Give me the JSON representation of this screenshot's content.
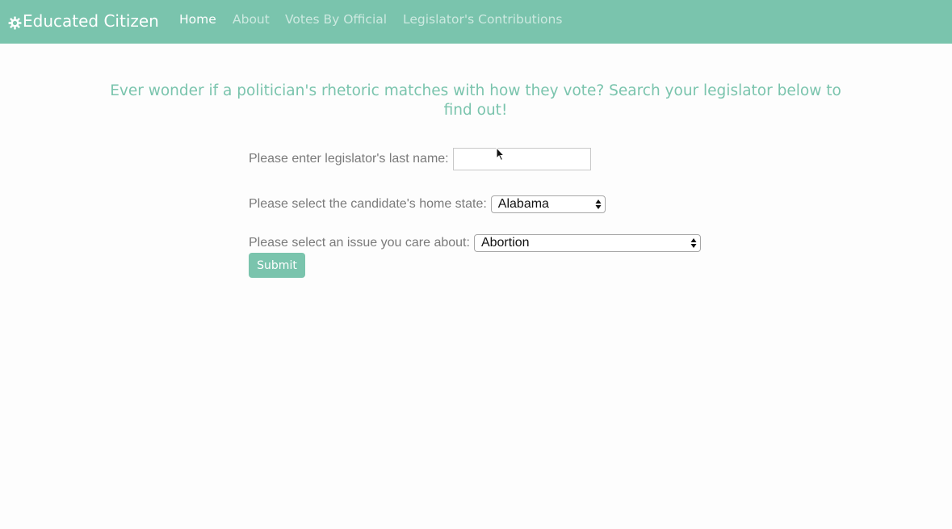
{
  "navbar": {
    "brand": "Educated Citizen",
    "brand_icon": "gear-icon",
    "links": [
      {
        "label": "Home",
        "active": true
      },
      {
        "label": "About",
        "active": false
      },
      {
        "label": "Votes By Official",
        "active": false
      },
      {
        "label": "Legislator's Contributions",
        "active": false
      }
    ]
  },
  "main": {
    "tagline": "Ever wonder if a politician's rhetoric matches with how they vote? Search your legislator below to find out!",
    "form": {
      "last_name_label": "Please enter legislator's last name:",
      "last_name_value": "",
      "state_label": "Please select the candidate's home state:",
      "state_selected": "Alabama",
      "issue_label": "Please select an issue you care about:",
      "issue_selected": "Abortion",
      "submit_label": "Submit"
    }
  },
  "colors": {
    "accent": "#7ac4ad",
    "label_text": "#7a7a7a",
    "background": "#fdfdfd"
  }
}
